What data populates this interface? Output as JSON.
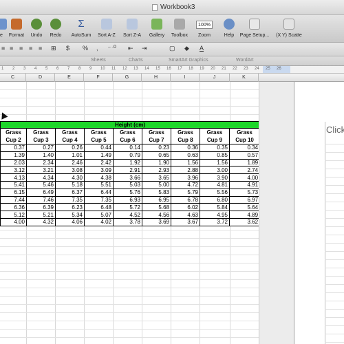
{
  "window": {
    "title": "Workbook3"
  },
  "toolbar": {
    "items": [
      {
        "label": "e",
        "icon": "edit-icon"
      },
      {
        "label": "Format",
        "icon": "format-icon"
      },
      {
        "label": "Undo",
        "icon": "undo-icon"
      },
      {
        "label": "Redo",
        "icon": "redo-icon"
      },
      {
        "label": "AutoSum",
        "icon": "sigma-icon"
      },
      {
        "label": "Sort A-Z",
        "icon": "sort-az-icon"
      },
      {
        "label": "Sort Z-A",
        "icon": "sort-za-icon"
      },
      {
        "label": "Gallery",
        "icon": "gallery-icon"
      },
      {
        "label": "Toolbox",
        "icon": "toolbox-icon"
      },
      {
        "label": "Zoom",
        "icon": "zoom-icon"
      },
      {
        "label": "Help",
        "icon": "help-icon"
      },
      {
        "label": "Page Setup...",
        "icon": "page-setup-icon"
      },
      {
        "label": "(X Y) Scatte",
        "icon": "scatter-icon"
      }
    ],
    "zoom_value": "100%",
    "accent_color": "#4a7fd4"
  },
  "formatbar": {
    "percent": "%",
    "comma": ",",
    "decimals": "←.0"
  },
  "ribbon": {
    "tabs": [
      "Sheets",
      "Charts",
      "SmartArt Graphics",
      "WordArt"
    ]
  },
  "ruler": {
    "ticks": [
      "1",
      "2",
      "3",
      "4",
      "5",
      "6",
      "7",
      "8",
      "9",
      "10",
      "11",
      "12",
      "13",
      "14",
      "15",
      "16",
      "17",
      "18",
      "19",
      "20",
      "21",
      "22",
      "23",
      "24",
      "25",
      "26"
    ]
  },
  "columns": [
    "D",
    "E",
    "F",
    "G",
    "H",
    "I",
    "J",
    "K"
  ],
  "first_column_letter": "C",
  "table": {
    "title": "Height (cm)",
    "title_color": "#1ed62a",
    "headers": [
      [
        "Grass",
        "Cup 2"
      ],
      [
        "Grass",
        "Cup 3"
      ],
      [
        "Grass",
        "Cup 4"
      ],
      [
        "Grass",
        "Cup 5"
      ],
      [
        "Grass",
        "Cup 6"
      ],
      [
        "Grass",
        "Cup 7"
      ],
      [
        "Grass",
        "Cup 8"
      ],
      [
        "Grass",
        "Cup 9"
      ],
      [
        "Grass",
        "Cup 10"
      ]
    ],
    "rows": [
      [
        "0.37",
        "0.27",
        "0.26",
        "0.44",
        "0.14",
        "0.23",
        "0.36",
        "0.35",
        "0.34"
      ],
      [
        "1.39",
        "1.40",
        "1.01",
        "1.49",
        "0.79",
        "0.65",
        "0.63",
        "0.85",
        "0.57"
      ],
      [
        "2.03",
        "2.34",
        "2.46",
        "2.42",
        "1.92",
        "1.90",
        "1.56",
        "1.56",
        "1.89"
      ],
      [
        "3.12",
        "3.21",
        "3.08",
        "3.09",
        "2.91",
        "2.93",
        "2.88",
        "3.00",
        "2.74"
      ],
      [
        "4.13",
        "4.34",
        "4.30",
        "4.38",
        "3.66",
        "3.65",
        "3.96",
        "3.90",
        "4.00"
      ],
      [
        "5.41",
        "5.46",
        "5.18",
        "5.51",
        "5.03",
        "5.00",
        "4.72",
        "4.81",
        "4.91"
      ],
      [
        "6.15",
        "6.49",
        "6.37",
        "6.44",
        "5.76",
        "5.83",
        "5.79",
        "5.56",
        "5.73"
      ],
      [
        "7.44",
        "7.46",
        "7.35",
        "7.35",
        "6.93",
        "6.95",
        "6.78",
        "6.80",
        "6.97"
      ],
      [
        "6.36",
        "6.39",
        "6.23",
        "6.48",
        "5.72",
        "5.68",
        "6.02",
        "5.84",
        "5.64"
      ],
      [
        "5.12",
        "5.21",
        "5.34",
        "5.07",
        "4.52",
        "4.56",
        "4.63",
        "4.95",
        "4.89"
      ],
      [
        "4.00",
        "4.32",
        "4.06",
        "4.02",
        "3.78",
        "3.69",
        "3.67",
        "3.72",
        "3.62"
      ]
    ]
  },
  "side_panel": {
    "text": "Click"
  }
}
